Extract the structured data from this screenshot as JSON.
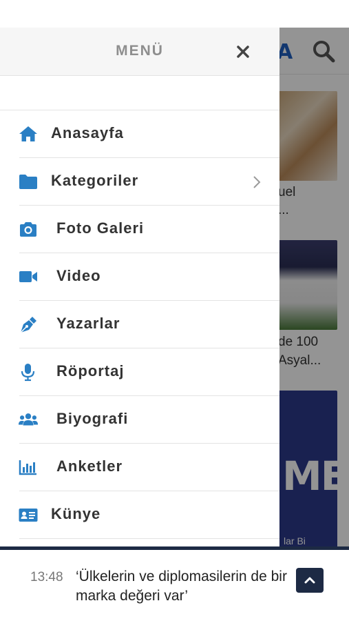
{
  "drawer": {
    "title": "MENÜ",
    "close_icon": "close-icon"
  },
  "menu": {
    "items": [
      {
        "label": "Anasayfa",
        "icon": "home-icon"
      },
      {
        "label": "Kategoriler",
        "icon": "folder-icon",
        "has_submenu": true
      },
      {
        "label": "Foto Galeri",
        "icon": "camera-icon"
      },
      {
        "label": "Video",
        "icon": "video-icon"
      },
      {
        "label": "Yazarlar",
        "icon": "pen-icon"
      },
      {
        "label": "Röportaj",
        "icon": "microphone-icon"
      },
      {
        "label": "Biyografi",
        "icon": "users-icon"
      },
      {
        "label": "Anketler",
        "icon": "chart-icon"
      },
      {
        "label": "Künye",
        "icon": "id-card-icon"
      }
    ]
  },
  "background": {
    "logo_fragment": "A",
    "card1_text_line1": "uel",
    "card1_text_line2": "...",
    "card2_text_line1": "de 100",
    "card2_text_line2": "Asyal...",
    "card3_big_text": "ME",
    "card3_small_text": "lar Bi"
  },
  "ticker": {
    "time": "13:48",
    "headline": "‘Ülkelerin ve diplomasilerin de bir marka değeri var’"
  },
  "colors": {
    "accent": "#2a7fc4",
    "dark": "#1d2a44",
    "text": "#333333",
    "muted": "#8e8e8e"
  }
}
